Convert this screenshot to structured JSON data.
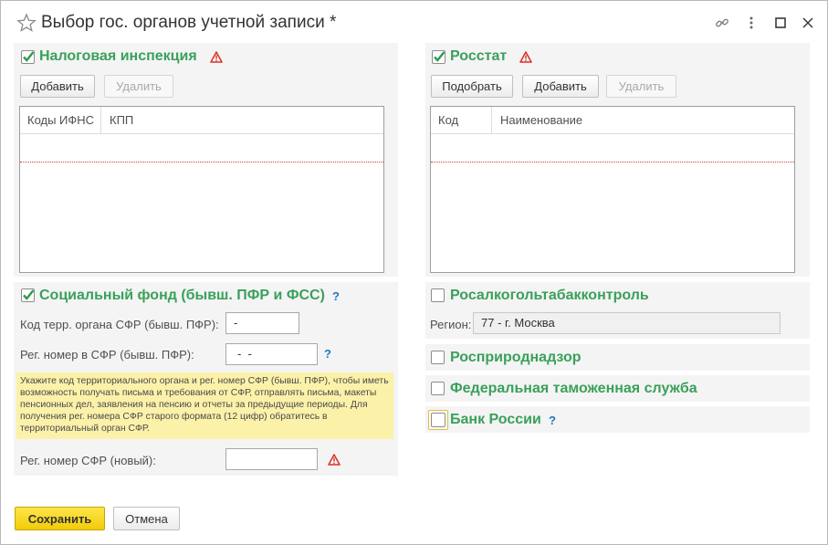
{
  "window": {
    "title": "Выбор гос. органов учетной записи *",
    "icons": [
      "favorite-star-icon",
      "link-icon",
      "more-vertical-icon",
      "maximize-icon",
      "close-icon"
    ]
  },
  "tax": {
    "title": "Налоговая инспекция",
    "checked": true,
    "add_label": "Добавить",
    "delete_label": "Удалить",
    "columns": [
      "Коды ИФНС",
      "КПП"
    ]
  },
  "rosstat": {
    "title": "Росстат",
    "checked": true,
    "pick_label": "Подобрать",
    "add_label": "Добавить",
    "delete_label": "Удалить",
    "columns": [
      "Код",
      "Наименование"
    ]
  },
  "sfr": {
    "title": "Социальный фонд (бывш. ПФР и ФСС)",
    "checked": true,
    "help": "?",
    "terr_code_label": "Код терр. органа СФР (бывш. ПФР):",
    "terr_code_value": "-",
    "reg_num_label": "Рег. номер в СФР (бывш. ПФР):",
    "reg_num_value": "-  -",
    "note": "Укажите код территориального органа и рег. номер СФР (бывш. ПФР), чтобы иметь возможность получать письма и требования от СФР, отправлять письма, макеты пенсионных дел, заявления на пенсию и отчеты за предыдущие периоды. Для получения рег. номера СФР старого формата (12 цифр) обратитесь в территориальный орган СФР.",
    "new_reg_label": "Рег. номер СФР (новый):",
    "new_reg_value": ""
  },
  "rosalko": {
    "title": "Росалкогольтабакконтроль",
    "checked": false,
    "region_label": "Регион:",
    "region_value": "77 - г. Москва"
  },
  "rosprirod": {
    "title": "Росприроднадзор",
    "checked": false
  },
  "customs": {
    "title": "Федеральная таможенная служба",
    "checked": false
  },
  "cbr": {
    "title": "Банк России",
    "checked": false,
    "help": "?"
  },
  "footer": {
    "save_label": "Сохранить",
    "cancel_label": "Отмена"
  },
  "colors": {
    "accent_green": "#3aa05a",
    "save_yellow": "#f7d515",
    "warning_red": "#d93025",
    "help_blue": "#1b78c2",
    "note_bg": "#fbf1a9"
  }
}
